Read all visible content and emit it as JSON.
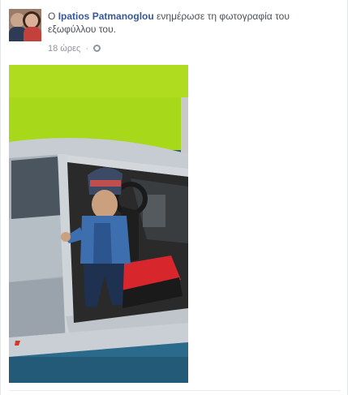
{
  "story": {
    "prefix": "Ο",
    "author": "Ipatios Patmanoglou",
    "action": "ενημέρωσε τη φωτογραφία του εξωφύλλου του.",
    "timestamp": "18 ώρες",
    "separator": "·",
    "privacy_icon": "globe-icon"
  },
  "colors": {
    "link": "#365899",
    "body_text": "#4b4f56",
    "meta_text": "#90949c"
  }
}
